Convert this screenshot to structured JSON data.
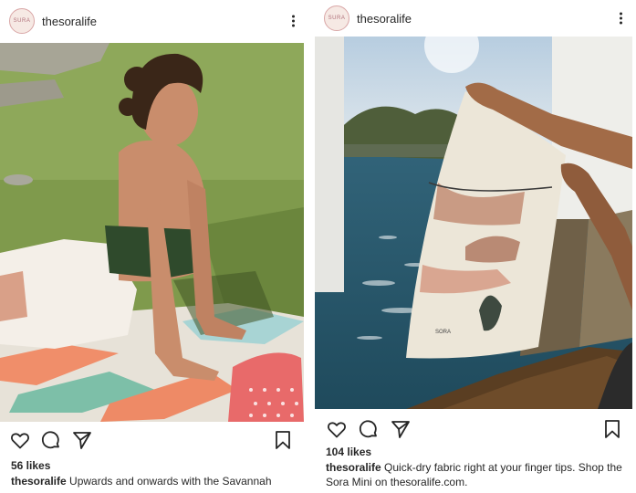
{
  "posts": [
    {
      "username": "thesoralife",
      "avatar_text": "SURA",
      "likes": "56 likes",
      "caption_user": "thesoralife",
      "caption_text": "Upwards and onwards with the Savannah"
    },
    {
      "username": "thesoralife",
      "avatar_text": "SURA",
      "likes": "104 likes",
      "caption_user": "thesoralife",
      "caption_text": "Quick-dry fabric right at your finger tips. Shop the Sora Mini on thesoralife.com.",
      "towel_label": "SORA"
    }
  ],
  "icons": [
    "heart-icon",
    "comment-icon",
    "share-icon",
    "bookmark-icon",
    "more-icon"
  ]
}
